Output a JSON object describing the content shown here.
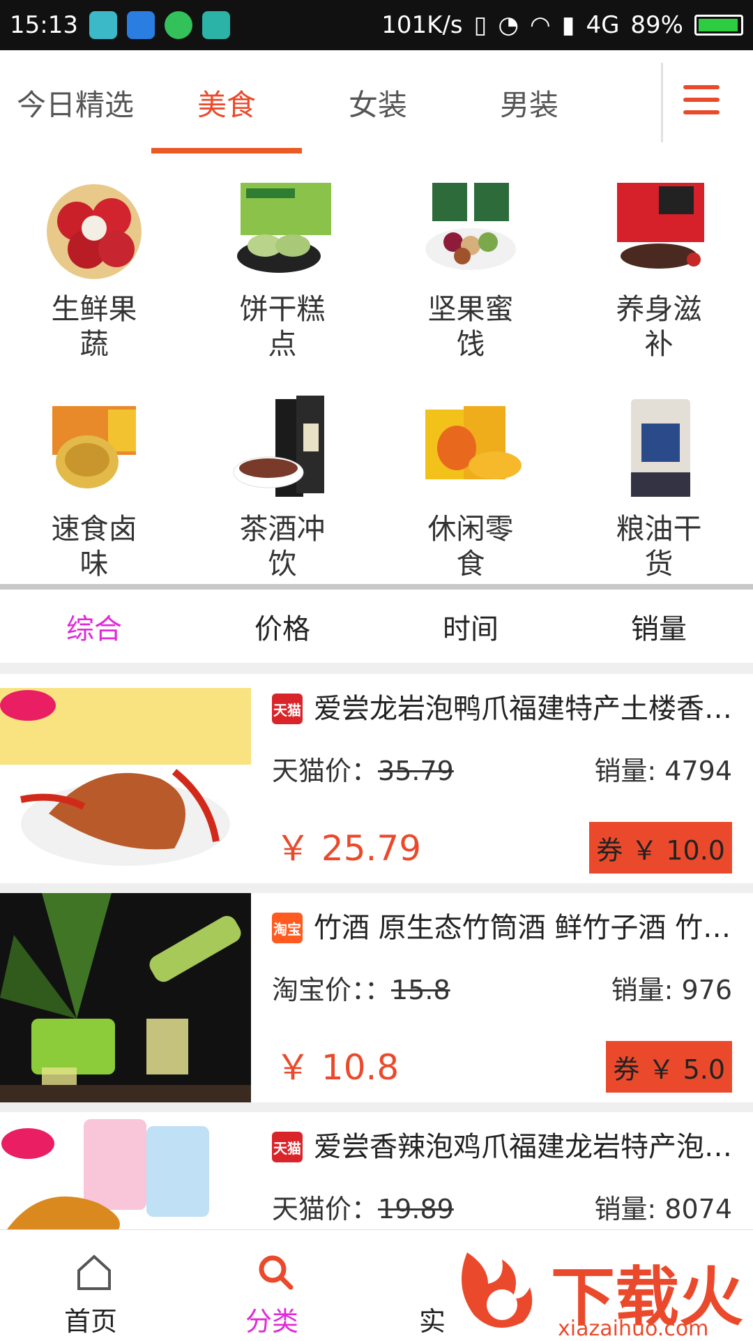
{
  "status_bar": {
    "time": "15:13",
    "speed": "101K/s",
    "network": "4G",
    "battery": "89%"
  },
  "top_tabs": [
    {
      "label": "今日精选"
    },
    {
      "label": "美食"
    },
    {
      "label": "女装"
    },
    {
      "label": "男装"
    }
  ],
  "categories": [
    {
      "label": "生鲜果蔬"
    },
    {
      "label": "饼干糕点"
    },
    {
      "label": "坚果蜜饯"
    },
    {
      "label": "养身滋补"
    },
    {
      "label": "速食卤味"
    },
    {
      "label": "茶酒冲饮"
    },
    {
      "label": "休闲零食"
    },
    {
      "label": "粮油干货"
    }
  ],
  "sort_tabs": [
    {
      "label": "综合"
    },
    {
      "label": "价格"
    },
    {
      "label": "时间"
    },
    {
      "label": "销量"
    }
  ],
  "products": [
    {
      "platform": "天猫",
      "title": "爱尝龙岩泡鸭爪福建特产土楼香辣泡鸭爪",
      "orig_label": "天猫价：",
      "orig_price": "35.79",
      "sales": "销量: 4794",
      "price": "￥  25.79",
      "coupon": "券 ￥ 10.0"
    },
    {
      "platform": "淘宝",
      "title": "竹酒 原生态竹筒酒 鲜竹子酒  竹筒酒",
      "orig_label": "淘宝价：：",
      "orig_price": "15.8",
      "sales": "销量: 976",
      "price": "￥  10.8",
      "coupon": "券 ￥ 5.0"
    },
    {
      "platform": "天猫",
      "title": "爱尝香辣泡鸡爪福建龙岩特产泡椒凤爪",
      "orig_label": "天猫价：",
      "orig_price": "19.89",
      "sales": "销量: 8074"
    }
  ],
  "bottom_nav": [
    {
      "label": "首页"
    },
    {
      "label": "分类"
    },
    {
      "label": "实"
    }
  ],
  "watermark": {
    "text": "下载火",
    "sub": "xiazaihuo.com"
  },
  "colors": {
    "accent": "#ea4a2b",
    "active_sort": "#e02ad8"
  }
}
